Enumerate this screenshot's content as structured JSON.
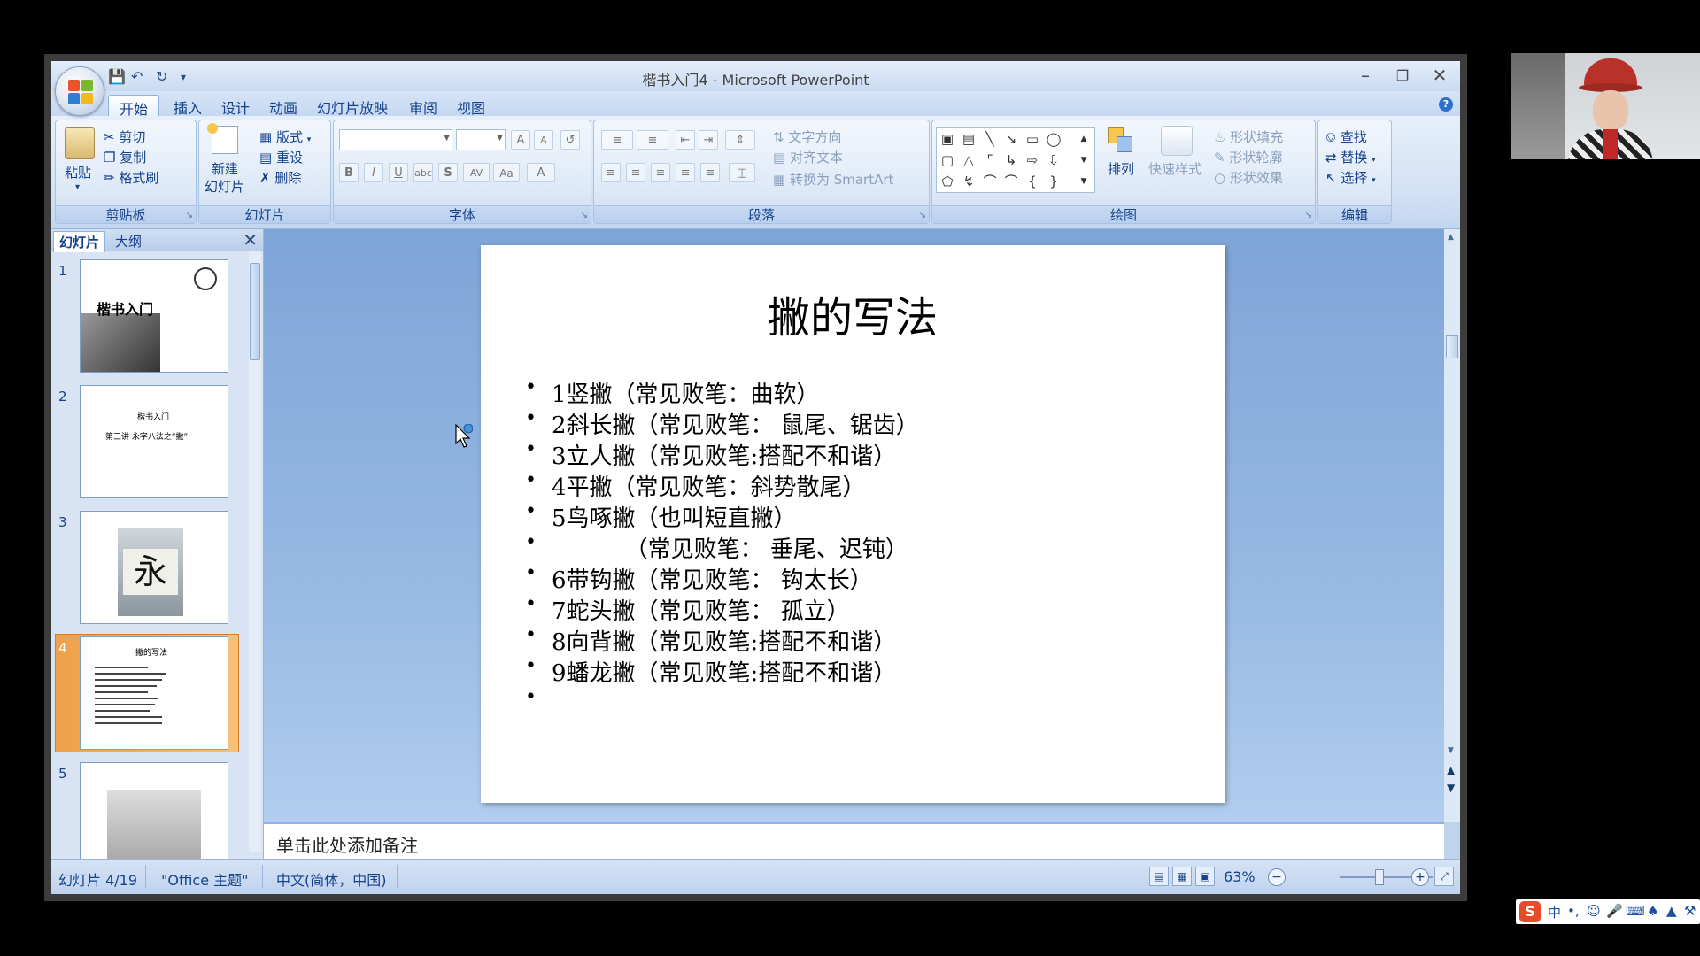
{
  "window": {
    "title": "楷书入门4 - Microsoft PowerPoint"
  },
  "ribbon_tabs": [
    "开始",
    "插入",
    "设计",
    "动画",
    "幻灯片放映",
    "审阅",
    "视图"
  ],
  "clipboard": {
    "paste": "粘贴",
    "cut": "剪切",
    "copy": "复制",
    "format_painter": "格式刷",
    "label": "剪贴板"
  },
  "slides_group": {
    "new_slide_1": "新建",
    "new_slide_2": "幻灯片",
    "layout": "版式",
    "reset": "重设",
    "delete": "删除",
    "label": "幻灯片"
  },
  "font_group": {
    "label": "字体",
    "bold": "B",
    "italic": "I",
    "underline": "U",
    "strike": "abc",
    "shadow": "S",
    "spacing": "AV",
    "case": "Aa",
    "color": "A",
    "grow": "A",
    "shrink": "A"
  },
  "paragraph_group": {
    "text_direction": "文字方向",
    "align_text": "对齐文本",
    "smartart": "转换为 SmartArt",
    "label": "段落"
  },
  "drawing_group": {
    "arrange": "排列",
    "quick_styles": "快速样式",
    "fill": "形状填充",
    "outline": "形状轮廓",
    "effects": "形状效果",
    "label": "绘图"
  },
  "editing_group": {
    "find": "查找",
    "replace": "替换",
    "select": "选择",
    "label": "编辑"
  },
  "pane_tabs": {
    "slides": "幻灯片",
    "outline": "大纲"
  },
  "thumbnails": [
    {
      "num": "1",
      "line1": "楷书入门"
    },
    {
      "num": "2",
      "line1": "楷书入门",
      "line2": "第三讲  永字八法之“撇”"
    },
    {
      "num": "3",
      "glyph": "永"
    },
    {
      "num": "4",
      "title": "撇的写法"
    },
    {
      "num": "5"
    }
  ],
  "slide": {
    "title": "撇的写法",
    "bullets": [
      "1竖撇（常见败笔：曲软）",
      "2斜长撇（常见败笔： 鼠尾、锯齿）",
      "3立人撇（常见败笔:搭配不和谐）",
      "4平撇（常见败笔：斜势散尾）",
      "5鸟啄撇（也叫短直撇）",
      "          （常见败笔： 垂尾、迟钝）",
      "6带钩撇（常见败笔：  钩太长）",
      "7蛇头撇（常见败笔：  孤立）",
      "8向背撇（常见败笔:搭配不和谐）",
      "9蟠龙撇（常见败笔:搭配不和谐）",
      ""
    ]
  },
  "notes": {
    "placeholder": "单击此处添加备注"
  },
  "status": {
    "slide_counter": "幻灯片 4/19",
    "theme": "\"Office 主题\"",
    "language": "中文(简体，中国)",
    "zoom": "63%",
    "zoom_fraction": 0.42
  },
  "ime": {
    "lang": "中"
  }
}
